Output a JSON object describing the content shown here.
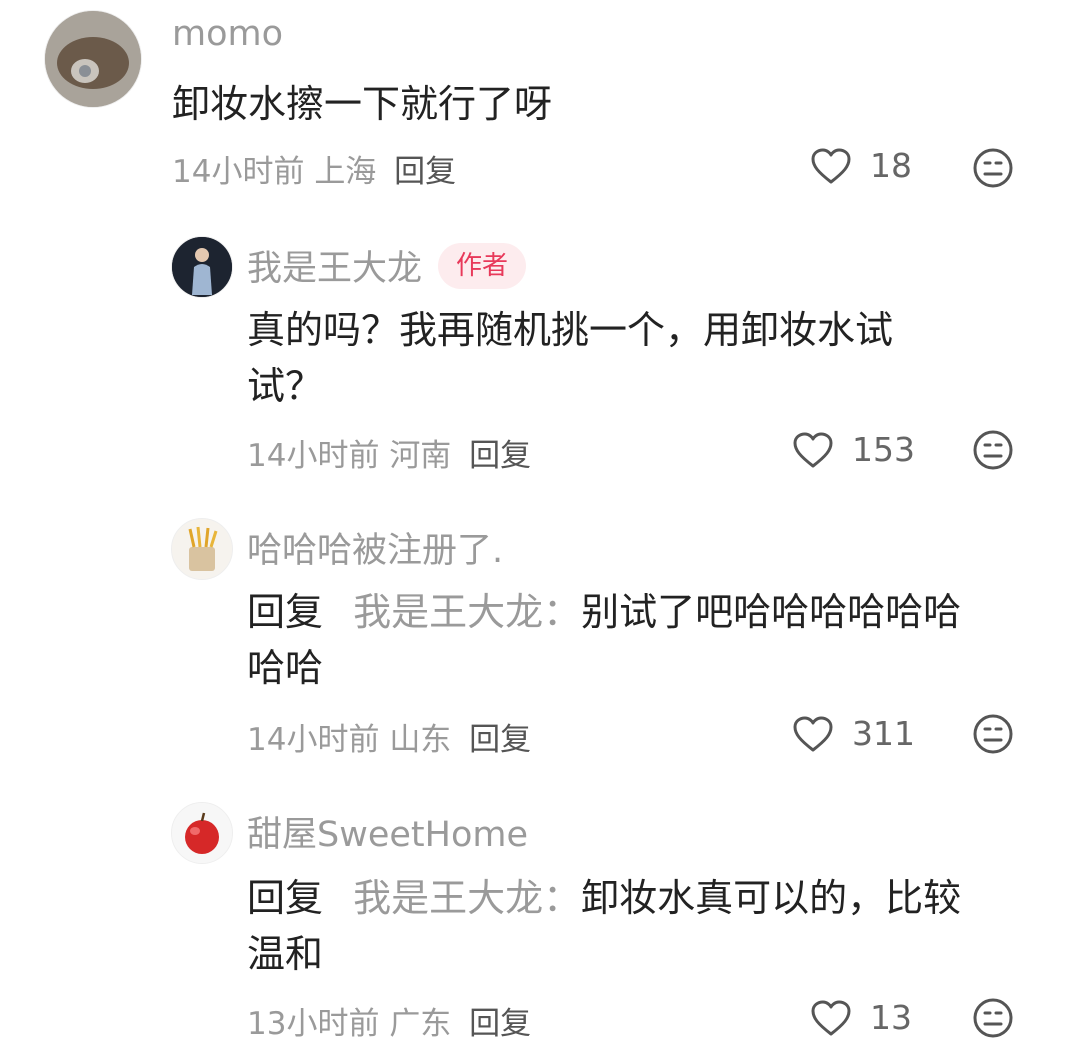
{
  "comments": [
    {
      "username": "momo",
      "badge": "",
      "reply_prefix": "",
      "reply_to": "",
      "text_line1": "卸妆水擦一下就行了呀",
      "text_line2": "",
      "time": "14小时前",
      "location": "上海",
      "reply_label": "回复",
      "likes": "18"
    },
    {
      "username": "我是王大龙",
      "badge": "作者",
      "reply_prefix": "",
      "reply_to": "",
      "text_line1": "真的吗？我再随机挑一个，用卸妆水试",
      "text_line2": "试？",
      "time": "14小时前",
      "location": "河南",
      "reply_label": "回复",
      "likes": "153"
    },
    {
      "username": "哈哈哈被注册了.",
      "badge": "",
      "reply_prefix": "回复",
      "reply_to": "我是王大龙：",
      "text_line1": "别试了吧哈哈哈哈哈哈",
      "text_line2": "哈哈",
      "time": "14小时前",
      "location": "山东",
      "reply_label": "回复",
      "likes": "311"
    },
    {
      "username": "甜屋SweetHome",
      "badge": "",
      "reply_prefix": "回复",
      "reply_to": "我是王大龙：",
      "text_line1": "卸妆水真可以的，比较",
      "text_line2": "温和",
      "time": "13小时前",
      "location": "广东",
      "reply_label": "回复",
      "likes": "13"
    }
  ],
  "colors": {
    "secondary_text": "#9a9a9a",
    "primary_text": "#222222",
    "author_badge_bg": "#fdecee",
    "author_badge_text": "#e8395a"
  }
}
